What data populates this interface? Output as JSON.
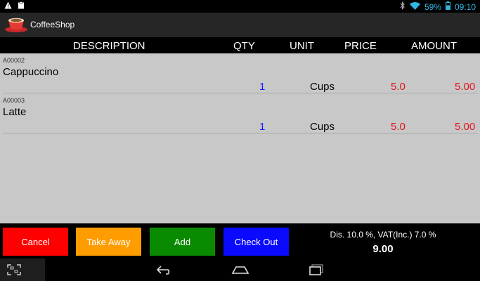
{
  "status_bar": {
    "battery": "59%",
    "time": "09:10",
    "icons": [
      "warning-icon",
      "clipboard-icon",
      "bluetooth-icon",
      "wifi-icon",
      "battery-icon"
    ]
  },
  "app": {
    "title": "CoffeeShop",
    "icon": "coffee-cup-icon"
  },
  "columns": {
    "description": "DESCRIPTION",
    "qty": "QTY",
    "unit": "UNIT",
    "price": "PRICE",
    "amount": "AMOUNT"
  },
  "items": [
    {
      "code": "A00002",
      "name": "Cappuccino",
      "qty": "1",
      "unit": "Cups",
      "price": "5.0",
      "amount": "5.00"
    },
    {
      "code": "A00003",
      "name": "Latte",
      "qty": "1",
      "unit": "Cups",
      "price": "5.0",
      "amount": "5.00"
    }
  ],
  "buttons": {
    "cancel": "Cancel",
    "take_away": "Take Away",
    "add": "Add",
    "check_out": "Check Out"
  },
  "summary": {
    "info": "Dis. 10.0 %, VAT(Inc.) 7.0 %",
    "total": "9.00"
  },
  "colors": {
    "cancel": "#ff0000",
    "take_away": "#ff9d00",
    "add": "#0a8a00",
    "check_out": "#0a0aff",
    "qty": "#1a1aff",
    "price": "#e0141e"
  }
}
